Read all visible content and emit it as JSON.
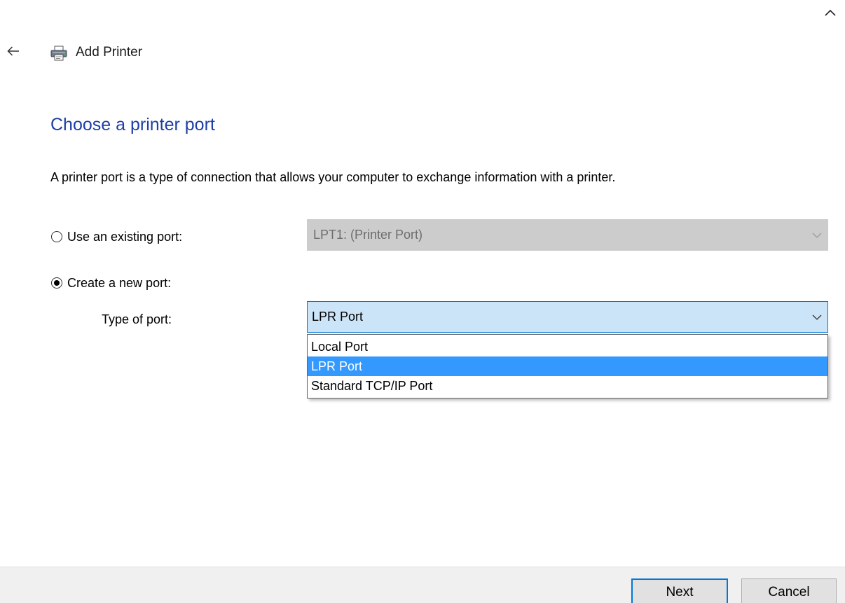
{
  "window": {
    "title": "Add Printer",
    "back_icon": "arrow-left-icon",
    "app_icon": "printer-icon",
    "collapse_icon": "chevron-up-icon"
  },
  "main": {
    "heading": "Choose a printer port",
    "description": "A printer port is a type of connection that allows your computer to exchange information with a printer."
  },
  "port_options": {
    "existing": {
      "label": "Use an existing port:",
      "selected": false,
      "combo_value": "LPT1: (Printer Port)",
      "enabled": false
    },
    "new": {
      "label": "Create a new port:",
      "selected": true,
      "type_label": "Type of port:",
      "combo_value": "LPR Port",
      "dropdown_open": true,
      "options": [
        "Local Port",
        "LPR Port",
        "Standard TCP/IP Port"
      ],
      "highlighted_index": 1
    }
  },
  "footer": {
    "next_label": "Next",
    "cancel_label": "Cancel"
  },
  "colors": {
    "heading": "#1e3fa6",
    "accent": "#0078d7",
    "selection": "#3399ff",
    "combo_active_bg": "#cce4f7",
    "combo_disabled_bg": "#cccccc"
  }
}
